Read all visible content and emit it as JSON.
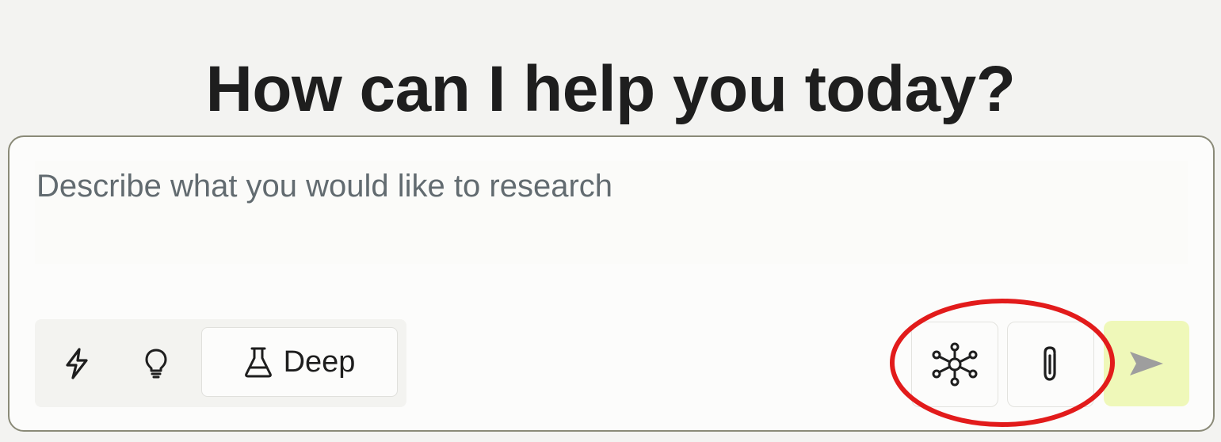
{
  "header": {
    "title": "How can I help you today?"
  },
  "composer": {
    "placeholder": "Describe what you would like to research",
    "value": "",
    "modes": [
      {
        "id": "quick",
        "icon": "lightning-bolt-icon",
        "label": ""
      },
      {
        "id": "think",
        "icon": "lightbulb-icon",
        "label": ""
      },
      {
        "id": "deep",
        "icon": "flask-icon",
        "label": "Deep",
        "selected": true
      }
    ],
    "tools": [
      {
        "id": "mcp",
        "icon": "network-hub-icon"
      },
      {
        "id": "attach",
        "icon": "paperclip-icon"
      }
    ],
    "send": {
      "icon": "send-arrow-icon",
      "enabled": false
    }
  },
  "colors": {
    "page_background": "#f3f3f1",
    "composer_border": "#8a8a78",
    "send_background": "#eff8b9",
    "send_icon": "#9e9e9e",
    "annotation_red": "#e21b1b",
    "placeholder_text": "#626b70"
  }
}
